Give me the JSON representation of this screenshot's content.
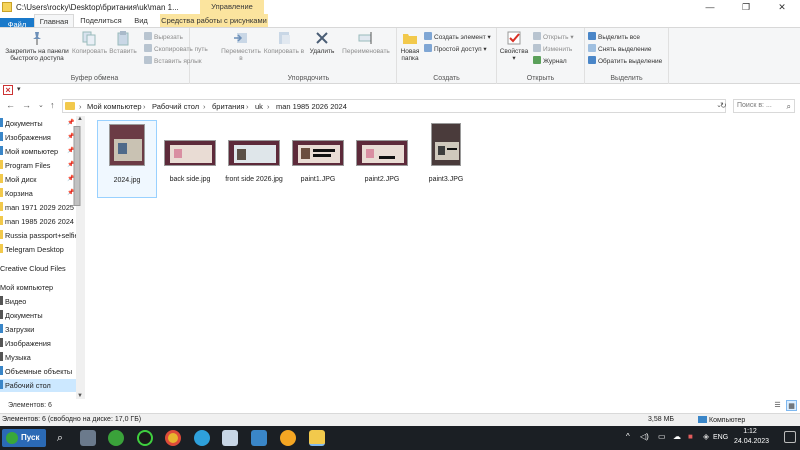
{
  "window": {
    "title": "C:\\Users\\rocky\\Desktop\\британия\\uk\\man 1...",
    "context_header": "Управление",
    "minimize": "—",
    "maximize": "❐",
    "close": "✕"
  },
  "tabs": [
    "Файл",
    "Главная",
    "Поделиться",
    "Вид",
    "Средства работы с рисунками"
  ],
  "ribbon": {
    "pin": "Закрепить на панели быстрого доступа",
    "copy": "Копировать",
    "paste": "Вставить",
    "cut": "Вырезать",
    "copy_path": "Скопировать путь",
    "paste_shortcut": "Вставить ярлык",
    "group_clipboard": "Буфер обмена",
    "move_to": "Переместить в",
    "copy_to": "Копировать в",
    "delete": "Удалить",
    "rename": "Переименовать",
    "group_organize": "Упорядочить",
    "new_folder": "Новая папка",
    "new_item": "Создать элемент",
    "easy_access": "Простой доступ",
    "group_create": "Создать",
    "properties": "Свойства",
    "open": "Открыть",
    "edit": "Изменить",
    "history": "Журнал",
    "group_open": "Открыть",
    "select_all": "Выделить все",
    "select_none": "Снять выделение",
    "invert_selection": "Обратить выделение",
    "group_select": "Выделить"
  },
  "address": {
    "crumbs": [
      "Мой компьютер",
      "Рабочий стол",
      "британия",
      "uk",
      "man 1985 2026 2024"
    ],
    "search_placeholder": "Поиск в: ..."
  },
  "sidebar": {
    "items": [
      {
        "label": "Документы",
        "pinned": true
      },
      {
        "label": "Изображения",
        "pinned": true
      },
      {
        "label": "Мой компьютер",
        "pinned": true
      },
      {
        "label": "Program Files",
        "pinned": true
      },
      {
        "label": "Мой диск",
        "pinned": true
      },
      {
        "label": "Корзина",
        "pinned": true
      },
      {
        "label": "man 1971 2029 2025",
        "pinned": false
      },
      {
        "label": "man 1985 2026 2024",
        "pinned": false
      },
      {
        "label": "Russia passport+selfie",
        "pinned": false
      },
      {
        "label": "Telegram Desktop",
        "pinned": false
      },
      {
        "label": "Creative Cloud Files",
        "pinned": false
      },
      {
        "label": "Мой компьютер",
        "pinned": false
      },
      {
        "label": "Видео",
        "pinned": false
      },
      {
        "label": "Документы",
        "pinned": false
      },
      {
        "label": "Загрузки",
        "pinned": false
      },
      {
        "label": "Изображения",
        "pinned": false
      },
      {
        "label": "Музыка",
        "pinned": false
      },
      {
        "label": "Объемные объекты",
        "pinned": false
      },
      {
        "label": "Рабочий стол",
        "pinned": false
      }
    ]
  },
  "files": [
    {
      "name": "2024.jpg",
      "selected": true
    },
    {
      "name": "back side.jpg",
      "selected": false
    },
    {
      "name": "front side 2026.jpg",
      "selected": false
    },
    {
      "name": "paint1.JPG",
      "selected": false
    },
    {
      "name": "paint2.JPG",
      "selected": false
    },
    {
      "name": "paint3.JPG",
      "selected": false
    }
  ],
  "status": {
    "count": "Элементов: 6",
    "details_left": "Элементов: 6 (свободно на диске: 17,0 ГБ)",
    "size": "3,58 МБ",
    "location": "Компьютер"
  },
  "taskbar": {
    "start": "Пуск",
    "lang": "ENG",
    "time": "1:12",
    "date": "24.04.2023"
  }
}
